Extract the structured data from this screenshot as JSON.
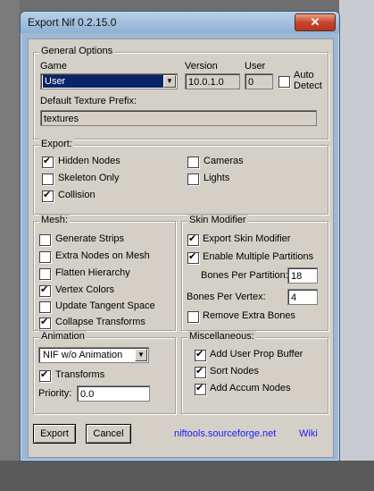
{
  "window": {
    "title": "Export Nif 0.2.15.0",
    "close_glyph": "✕"
  },
  "general": {
    "legend": "General Options",
    "game_label": "Game",
    "game_value": "User",
    "version_label": "Version",
    "version_value": "10.0.1.0",
    "user_label": "User",
    "user_value": "0",
    "auto_detect_line1": "Auto",
    "auto_detect_line2": "Detect",
    "auto_detect_checked": false,
    "texture_prefix_label": "Default Texture Prefix:",
    "texture_prefix_value": "textures"
  },
  "export": {
    "legend": "Export:",
    "hidden_nodes": {
      "label": "Hidden Nodes",
      "checked": true
    },
    "skeleton_only": {
      "label": "Skeleton Only",
      "checked": false
    },
    "collision": {
      "label": "Collision",
      "checked": true
    },
    "cameras": {
      "label": "Cameras",
      "checked": false
    },
    "lights": {
      "label": "Lights",
      "checked": false
    }
  },
  "mesh": {
    "legend": "Mesh:",
    "generate_strips": {
      "label": "Generate Strips",
      "checked": false
    },
    "extra_nodes": {
      "label": "Extra Nodes on Mesh",
      "checked": false
    },
    "flatten_hierarchy": {
      "label": "Flatten Hierarchy",
      "checked": false
    },
    "vertex_colors": {
      "label": "Vertex Colors",
      "checked": true
    },
    "update_tangent": {
      "label": "Update Tangent Space",
      "checked": false
    },
    "collapse_transforms": {
      "label": "Collapse Transforms",
      "checked": true
    }
  },
  "skin": {
    "legend": "Skin Modifier",
    "export_skin": {
      "label": "Export Skin Modifier",
      "checked": true
    },
    "multiple_partitions": {
      "label": "Enable Multiple Partitions",
      "checked": true
    },
    "bones_per_partition_label": "Bones Per Partition:",
    "bones_per_partition_value": "18",
    "bones_per_vertex_label": "Bones Per Vertex:",
    "bones_per_vertex_value": "4",
    "remove_extra_bones": {
      "label": "Remove Extra Bones",
      "checked": false
    }
  },
  "animation": {
    "legend": "Animation",
    "type_value": "NIF w/o Animation",
    "transforms": {
      "label": "Transforms",
      "checked": true
    },
    "priority_label": "Priority:",
    "priority_value": "0.0"
  },
  "misc": {
    "legend": "Miscellaneous:",
    "user_prop_buffer": {
      "label": "Add User Prop Buffer",
      "checked": true
    },
    "sort_nodes": {
      "label": "Sort Nodes",
      "checked": true
    },
    "accum_nodes": {
      "label": "Add Accum Nodes",
      "checked": true
    }
  },
  "footer": {
    "export_label": "Export",
    "cancel_label": "Cancel",
    "site_link": "niftools.sourceforge.net",
    "wiki_link": "Wiki"
  },
  "colors": {
    "dialog_face": "#d4d0c8",
    "title_bar": "#9bb7d4",
    "link": "#1a1aff",
    "selection": "#0a246a"
  }
}
